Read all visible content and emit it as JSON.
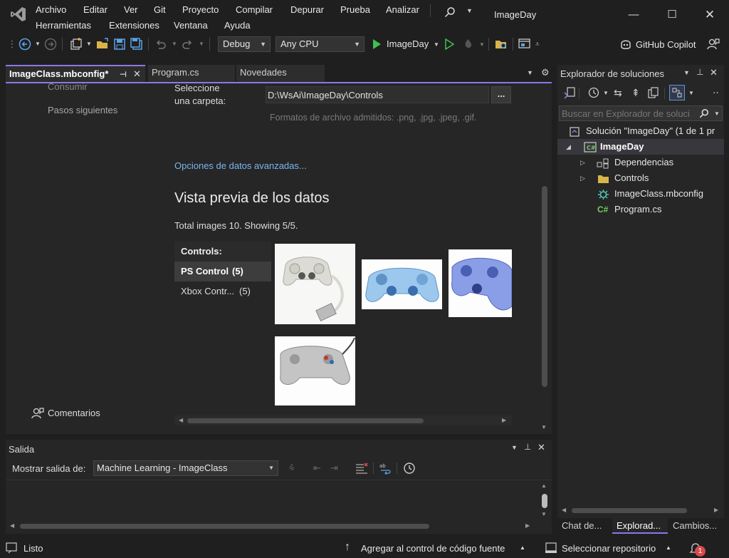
{
  "menu": {
    "row1": [
      "Archivo",
      "Editar",
      "Ver",
      "Git",
      "Proyecto",
      "Compilar",
      "Depurar",
      "Prueba",
      "Analizar"
    ],
    "row2": [
      "Herramientas",
      "Extensiones",
      "Ventana",
      "Ayuda"
    ],
    "app_title": "ImageDay"
  },
  "toolbar": {
    "config": "Debug",
    "platform": "Any CPU",
    "run_target": "ImageDay",
    "copilot": "GitHub Copilot"
  },
  "tabs": [
    {
      "label": "ImageClass.mbconfig*",
      "active": true
    },
    {
      "label": "Program.cs",
      "active": false
    },
    {
      "label": "Novedades",
      "active": false
    }
  ],
  "editor": {
    "nav": {
      "consumir": "Consumir",
      "pasos": "Pasos siguientes",
      "comentarios": "Comentarios"
    },
    "folder_label_1": "Seleccione",
    "folder_label_2": "una carpeta:",
    "folder_path": "D:\\WsAi\\ImageDay\\Controls",
    "browse_button": "...",
    "formats_hint": "Formatos de archivo admitidos: .png, .jpg, .jpeg, .gif.",
    "advanced_link": "Opciones de datos avanzadas...",
    "preview_title": "Vista previa de los datos",
    "summary": "Total images 10. Showing 5/5.",
    "classes_header": "Controls:",
    "classes": [
      {
        "name": "PS Control",
        "count": "(5)",
        "selected": true
      },
      {
        "name": "Xbox Contr...",
        "count": "(5)",
        "selected": false
      }
    ]
  },
  "output": {
    "title": "Salida",
    "show_from_label": "Mostrar salida de:",
    "source": "Machine Learning - ImageClass"
  },
  "solution_explorer": {
    "title": "Explorador de soluciones",
    "search_placeholder": "Buscar en Explorador de soluci",
    "solution": "Solución \"ImageDay\"  (1 de 1 pr",
    "project": "ImageDay",
    "items": [
      "Dependencias",
      "Controls",
      "ImageClass.mbconfig",
      "Program.cs"
    ],
    "bottom_tabs": [
      "Chat de...",
      "Explorad...",
      "Cambios..."
    ]
  },
  "status": {
    "ready": "Listo",
    "add_source_control": "Agregar al control de código fuente",
    "select_repo": "Seleccionar repositorio",
    "notifications": "1"
  },
  "colors": {
    "accent": "#8f76e6",
    "link": "#7ab6ee",
    "selected_class": "#3d3d3d"
  }
}
